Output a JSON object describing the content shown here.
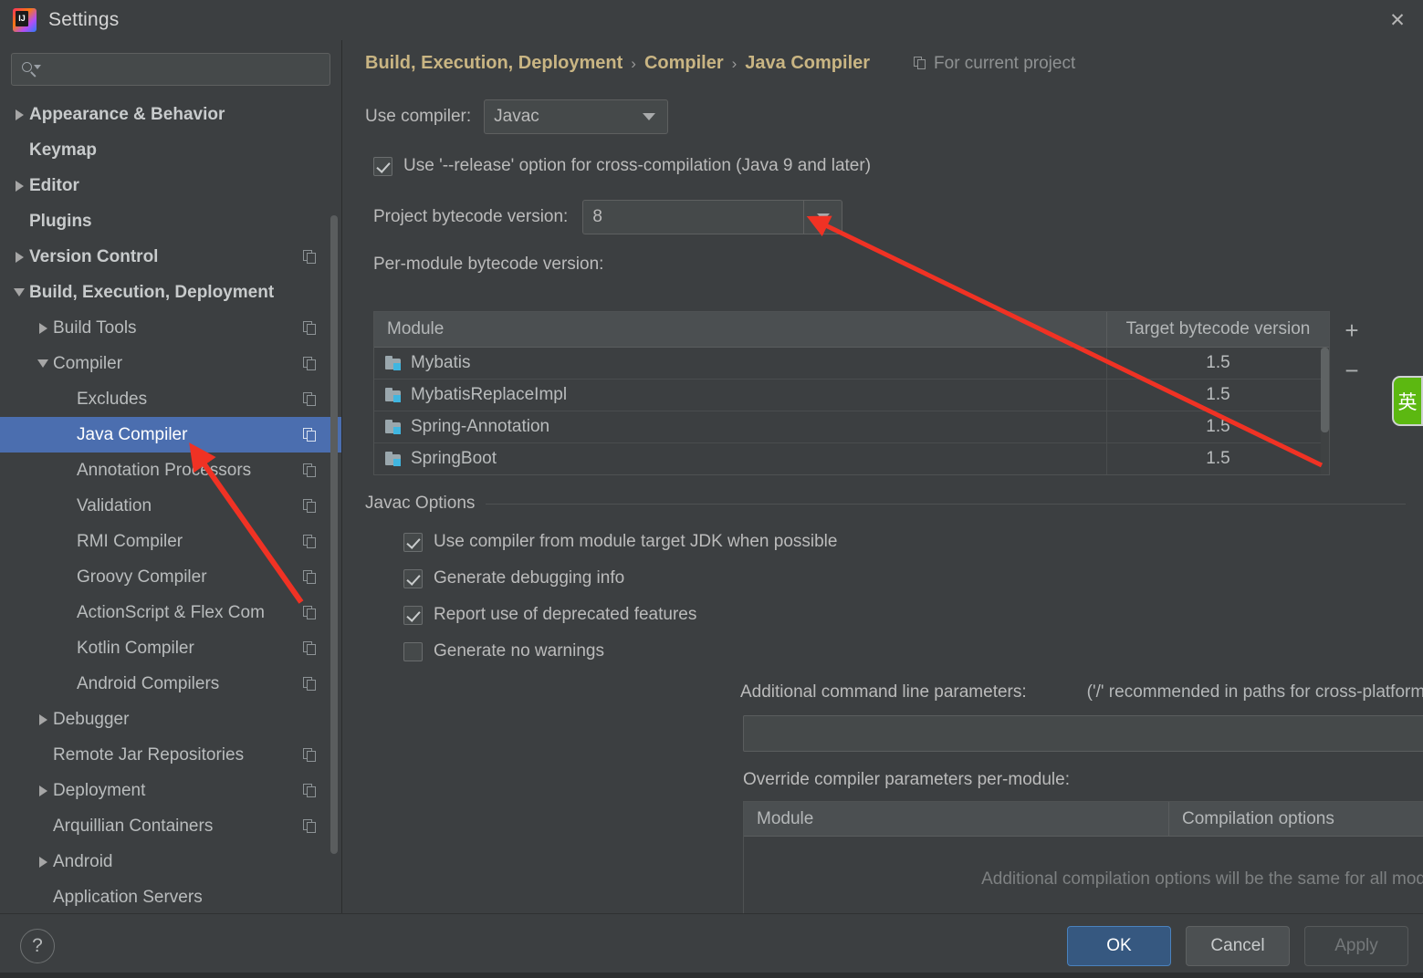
{
  "window": {
    "title": "Settings",
    "logo_icon": "intellij-idea-logo",
    "close_icon": "close-icon"
  },
  "sidebar": {
    "search": {
      "placeholder": "",
      "value": "",
      "icon": "search-icon"
    },
    "items": [
      {
        "label": "Appearance & Behavior",
        "indent": 0,
        "twisty": "right",
        "bold": true,
        "copy": false,
        "selected": false
      },
      {
        "label": "Keymap",
        "indent": 0,
        "twisty": "none",
        "bold": true,
        "copy": false,
        "selected": false
      },
      {
        "label": "Editor",
        "indent": 0,
        "twisty": "right",
        "bold": true,
        "copy": false,
        "selected": false
      },
      {
        "label": "Plugins",
        "indent": 0,
        "twisty": "none",
        "bold": true,
        "copy": false,
        "selected": false
      },
      {
        "label": "Version Control",
        "indent": 0,
        "twisty": "right",
        "bold": true,
        "copy": true,
        "selected": false
      },
      {
        "label": "Build, Execution, Deployment",
        "indent": 0,
        "twisty": "down",
        "bold": true,
        "copy": false,
        "selected": false
      },
      {
        "label": "Build Tools",
        "indent": 1,
        "twisty": "right",
        "bold": false,
        "copy": true,
        "selected": false
      },
      {
        "label": "Compiler",
        "indent": 1,
        "twisty": "down",
        "bold": false,
        "copy": true,
        "selected": false
      },
      {
        "label": "Excludes",
        "indent": 2,
        "twisty": "none",
        "bold": false,
        "copy": true,
        "selected": false
      },
      {
        "label": "Java Compiler",
        "indent": 2,
        "twisty": "none",
        "bold": false,
        "copy": true,
        "selected": true
      },
      {
        "label": "Annotation Processors",
        "indent": 2,
        "twisty": "none",
        "bold": false,
        "copy": true,
        "selected": false
      },
      {
        "label": "Validation",
        "indent": 2,
        "twisty": "none",
        "bold": false,
        "copy": true,
        "selected": false
      },
      {
        "label": "RMI Compiler",
        "indent": 2,
        "twisty": "none",
        "bold": false,
        "copy": true,
        "selected": false
      },
      {
        "label": "Groovy Compiler",
        "indent": 2,
        "twisty": "none",
        "bold": false,
        "copy": true,
        "selected": false
      },
      {
        "label": "ActionScript & Flex Com",
        "indent": 2,
        "twisty": "none",
        "bold": false,
        "copy": true,
        "selected": false
      },
      {
        "label": "Kotlin Compiler",
        "indent": 2,
        "twisty": "none",
        "bold": false,
        "copy": true,
        "selected": false
      },
      {
        "label": "Android Compilers",
        "indent": 2,
        "twisty": "none",
        "bold": false,
        "copy": true,
        "selected": false
      },
      {
        "label": "Debugger",
        "indent": 1,
        "twisty": "right",
        "bold": false,
        "copy": false,
        "selected": false
      },
      {
        "label": "Remote Jar Repositories",
        "indent": 1,
        "twisty": "none",
        "bold": false,
        "copy": true,
        "selected": false
      },
      {
        "label": "Deployment",
        "indent": 1,
        "twisty": "right",
        "bold": false,
        "copy": true,
        "selected": false
      },
      {
        "label": "Arquillian Containers",
        "indent": 1,
        "twisty": "none",
        "bold": false,
        "copy": true,
        "selected": false
      },
      {
        "label": "Android",
        "indent": 1,
        "twisty": "right",
        "bold": false,
        "copy": false,
        "selected": false
      },
      {
        "label": "Application Servers",
        "indent": 1,
        "twisty": "none",
        "bold": false,
        "copy": false,
        "selected": false
      }
    ]
  },
  "main": {
    "breadcrumb": {
      "parts": [
        "Build, Execution, Deployment",
        "Compiler",
        "Java Compiler"
      ],
      "separator": "›",
      "scope_label": "For current project",
      "scope_icon": "copy-icon"
    },
    "use_compiler": {
      "label": "Use compiler:",
      "value": "Javac",
      "dropdown_icon": "chevron-down-icon"
    },
    "release_option": {
      "label": "Use '--release' option for cross-compilation (Java 9 and later)",
      "checked": true
    },
    "project_bytecode": {
      "label": "Project bytecode version:",
      "value": "8",
      "dropdown_icon": "chevron-down-icon"
    },
    "per_module_label": "Per-module bytecode version:",
    "module_table": {
      "columns": [
        "Module",
        "Target bytecode version"
      ],
      "rows": [
        {
          "module": "Mybatis",
          "target": "1.5",
          "icon": "module-folder-icon"
        },
        {
          "module": "MybatisReplaceImpl",
          "target": "1.5",
          "icon": "module-folder-icon"
        },
        {
          "module": "Spring-Annotation",
          "target": "1.5",
          "icon": "module-folder-icon"
        },
        {
          "module": "SpringBoot",
          "target": "1.5",
          "icon": "module-folder-icon"
        }
      ],
      "add_label": "+",
      "remove_label": "−"
    },
    "javac_options": {
      "group_title": "Javac Options",
      "checkboxes": [
        {
          "label": "Use compiler from module target JDK when possible",
          "checked": true
        },
        {
          "label": "Generate debugging info",
          "checked": true
        },
        {
          "label": "Report use of deprecated features",
          "checked": true
        },
        {
          "label": "Generate no warnings",
          "checked": false
        }
      ],
      "params_label": "Additional command line parameters:",
      "params_hint": "('/' recommended in paths for cross-platform configurations)",
      "params_value": "",
      "params_placeholder": "",
      "expand_icon": "expand-icon"
    },
    "override_section": {
      "label": "Override compiler parameters per-module:",
      "columns": [
        "Module",
        "Compilation options"
      ],
      "empty_text": "Additional compilation options will be the same for all modules",
      "add_label": "+",
      "remove_label": "−"
    }
  },
  "footer": {
    "help_label": "?",
    "ok_label": "OK",
    "cancel_label": "Cancel",
    "apply_label": "Apply"
  },
  "overlay": {
    "ime_badge": "英",
    "annotation_color": "#f03224"
  }
}
